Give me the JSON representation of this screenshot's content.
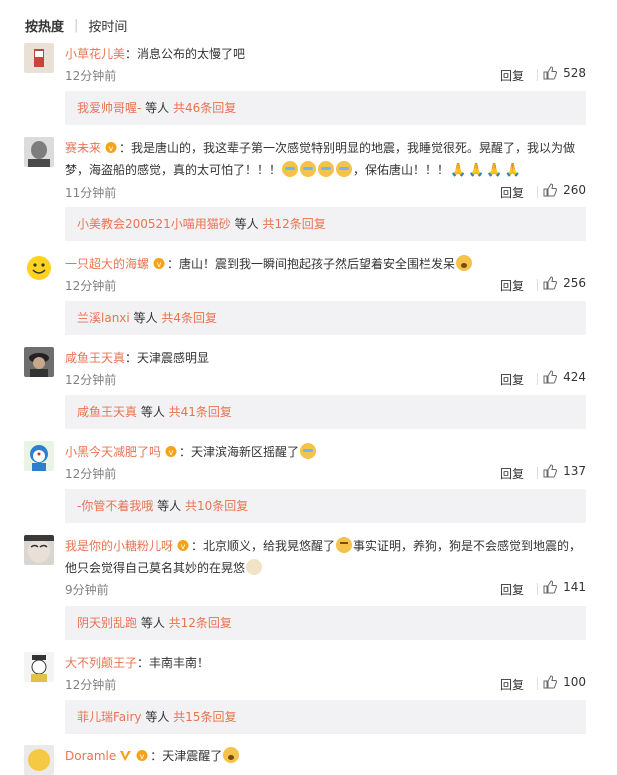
{
  "sort": {
    "hot": "按热度",
    "time": "按时间"
  },
  "comments": [
    {
      "name": "小草花儿美",
      "sep": "：",
      "text": "消息公布的太慢了吧",
      "time": "12分钟前",
      "reply": "回复",
      "likes": "528",
      "replies": {
        "who": "我爱帅哥喔-",
        "mid": " 等人 ",
        "total": "共46条回复"
      }
    },
    {
      "name": "赛未来",
      "sep": "：",
      "text1": "我是唐山的，我这辈子第一次感觉特别明显的地震，我睡觉很死。晃醒了，我以为做",
      "text2a": "梦，海盗船的感觉，真的太可怕了！！！",
      "text2b": "，保佑唐山！！！",
      "time": "11分钟前",
      "reply": "回复",
      "likes": "260",
      "replies": {
        "who": "小美教会200521小喵用猫砂",
        "mid": " 等人 ",
        "total": "共12条回复"
      }
    },
    {
      "name": "一只超大的海螺",
      "sep": "：",
      "text": "唐山！震到我一瞬间抱起孩子然后望着安全围栏发呆",
      "time": "12分钟前",
      "reply": "回复",
      "likes": "256",
      "replies": {
        "who": "兰溪lanxi",
        "mid": " 等人 ",
        "total": "共4条回复"
      }
    },
    {
      "name": "咸鱼王天真",
      "sep": "：",
      "text": "天津震感明显",
      "time": "12分钟前",
      "reply": "回复",
      "likes": "424",
      "replies": {
        "who": "咸鱼王天真",
        "mid": " 等人 ",
        "total": "共41条回复"
      }
    },
    {
      "name": "小黑今天减肥了吗",
      "sep": "：",
      "text": "天津滨海新区摇醒了",
      "time": "12分钟前",
      "reply": "回复",
      "likes": "137",
      "replies": {
        "who": "-你管不着我哦",
        "mid": " 等人 ",
        "total": "共10条回复"
      }
    },
    {
      "name": "我是你的小糖粉儿呀",
      "sep": "：",
      "text1a": "北京顺义，给我晃悠醒了",
      "text1b": "事实证明，养狗，狗是不会感觉到地震的，",
      "text2": "他只会觉得自己莫名其妙的在晃悠",
      "time": "9分钟前",
      "reply": "回复",
      "likes": "141",
      "replies": {
        "who": "阴天别乱跑",
        "mid": " 等人 ",
        "total": "共12条回复"
      }
    },
    {
      "name": "大不列颠王子",
      "sep": "：",
      "text": "丰南丰南！",
      "time": "12分钟前",
      "reply": "回复",
      "likes": "100",
      "replies": {
        "who": "菲儿瑞Fairy",
        "mid": " 等人 ",
        "total": "共15条回复"
      }
    },
    {
      "name": "Doramle",
      "sep": "：",
      "text": "天津震醒了"
    }
  ]
}
